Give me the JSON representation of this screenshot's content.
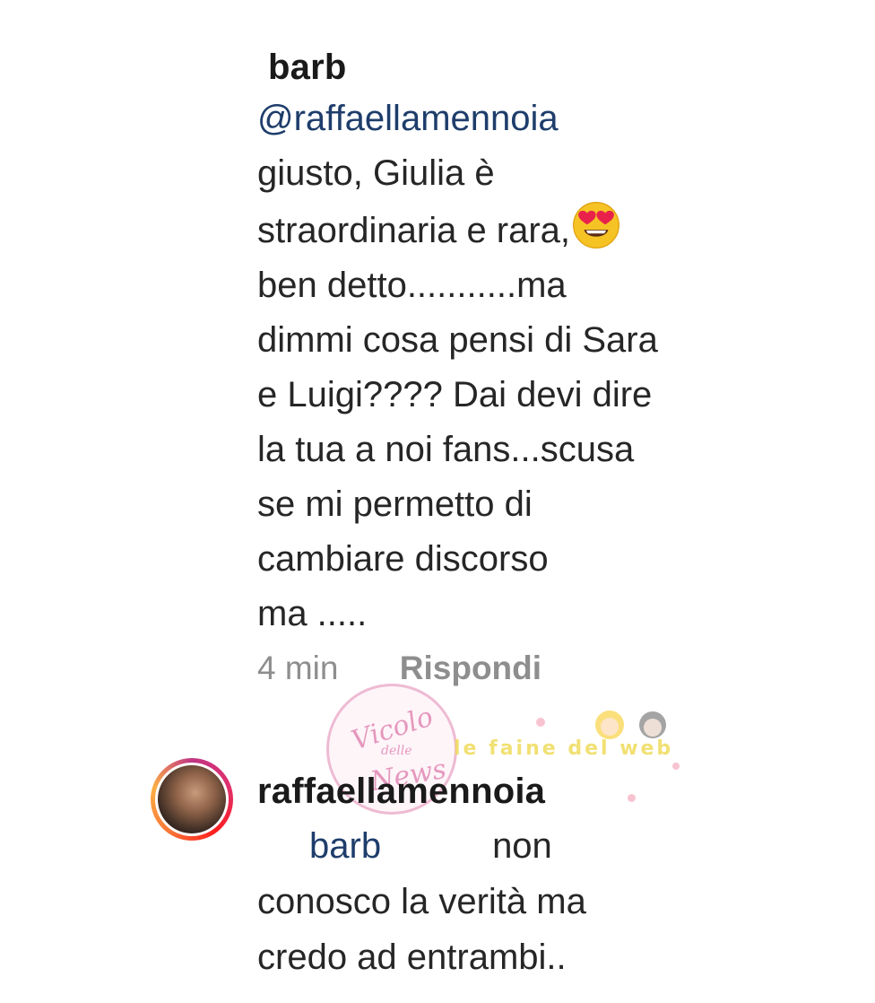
{
  "comment": {
    "username": "barb",
    "mention": "@raffaellamennoia",
    "lines": [
      "giusto, Giulia è",
      "straordinaria e rara,",
      "ben detto...........ma",
      "dimmi cosa pensi di Sara",
      "e Luigi???? Dai devi dire",
      "la tua a noi fans...scusa",
      "se mi permetto di",
      "cambiare discorso",
      "ma ....."
    ],
    "emoji": "heart-eyes-emoji",
    "time": "4 min",
    "reply_label": "Rispondi"
  },
  "reply": {
    "username": "raffaellamennoia",
    "mention": "barb",
    "lines": [
      "non",
      "conosco la verità ma",
      "credo ad entrambi.."
    ]
  },
  "watermark": {
    "line1": "Vicolo",
    "line2": "delle",
    "line3": "News",
    "tagline": "le faine del web"
  }
}
